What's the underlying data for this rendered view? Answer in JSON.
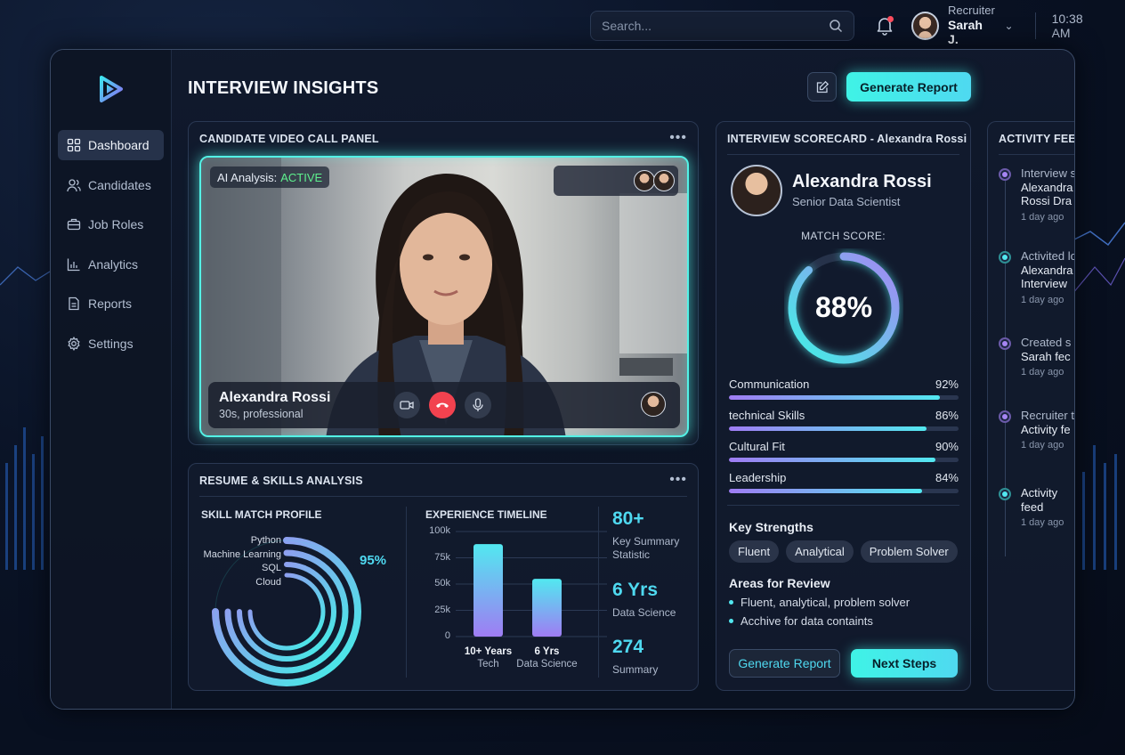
{
  "topbar": {
    "search_placeholder": "Search...",
    "user_role": "Recruiter",
    "user_name": "Sarah J.",
    "time": "10:38 AM"
  },
  "sidebar": {
    "items": [
      {
        "label": "Dashboard",
        "icon": "grid-icon",
        "active": true
      },
      {
        "label": "Candidates",
        "icon": "users-icon"
      },
      {
        "label": "Job Roles",
        "icon": "briefcase-icon"
      },
      {
        "label": "Analytics",
        "icon": "bar-chart-icon"
      },
      {
        "label": "Reports",
        "icon": "document-icon"
      },
      {
        "label": "Settings",
        "icon": "gear-icon"
      }
    ]
  },
  "header": {
    "title": "INTERVIEW INSIGHTS",
    "generate_label": "Generate Report"
  },
  "video_panel": {
    "title": "CANDIDATE VIDEO CALL PANEL",
    "ai_label": "AI Analysis:",
    "ai_status": "ACTIVE",
    "candidate_name": "Alexandra Rossi",
    "candidate_sub": "30s, professional"
  },
  "resume": {
    "title": "RESUME & SKILLS ANALYSIS",
    "skill_title": "SKILL MATCH PROFILE",
    "skills": [
      "Python",
      "Machine Learning",
      "SQL",
      "Cloud"
    ],
    "skill_percent": "95%",
    "timeline_title": "EXPERIENCE TIMELINE",
    "stats": [
      {
        "value": "80+",
        "label": "Key Summary Statistic"
      },
      {
        "value": "6 Yrs",
        "label": "Data Science"
      },
      {
        "value": "274",
        "label": "Summary"
      }
    ]
  },
  "chart_data": {
    "type": "bar",
    "title": "EXPERIENCE TIMELINE",
    "categories": [
      {
        "main": "10+ Years",
        "sub": "Tech"
      },
      {
        "main": "6 Yrs",
        "sub": "Data Science"
      }
    ],
    "values": [
      88000,
      55000
    ],
    "yticks": [
      "100k",
      "75k",
      "50k",
      "25k",
      "0"
    ],
    "ylim": [
      0,
      100000
    ],
    "grid": true
  },
  "scorecard": {
    "title": "INTERVIEW SCORECARD - Alexandra Rossi",
    "name": "Alexandra Rossi",
    "role": "Senior Data Scientist",
    "match_label": "MATCH SCORE:",
    "match_value": "88%",
    "match_fraction": 0.88,
    "metrics": [
      {
        "label": "Communication",
        "value": "92%",
        "fraction": 0.92
      },
      {
        "label": "technical Skills",
        "value": "86%",
        "fraction": 0.86
      },
      {
        "label": "Cultural Fit",
        "value": "90%",
        "fraction": 0.9
      },
      {
        "label": "Leadership",
        "value": "84%",
        "fraction": 0.84
      }
    ],
    "strengths_title": "Key Strengths",
    "strengths": [
      "Fluent",
      "Analytical",
      "Problem Solver"
    ],
    "review_title": "Areas for Review",
    "review_items": [
      "Fluent, analytical, problem solver",
      "Acchive for data containts"
    ],
    "generate_label": "Generate Report",
    "next_label": "Next Steps"
  },
  "feed": {
    "title": "ACTIVITY FEED",
    "items": [
      {
        "line1": "Interview s",
        "line2": "Alexandra",
        "line3": "Rossi Dra",
        "time": "1 day ago",
        "color": "purple"
      },
      {
        "line1": "Activited lo",
        "line2": "Alexandra",
        "line3": "Interview",
        "time": "1 day ago",
        "color": "cyan"
      },
      {
        "line1": "Created s",
        "line2": "Sarah fec",
        "line3": "",
        "time": "1 day ago",
        "color": "purple"
      },
      {
        "line1": "Recruiter t",
        "line2": "Activity fe",
        "line3": "",
        "time": "1 day ago",
        "color": "purple"
      },
      {
        "line1": "Activity",
        "line2": "feed",
        "line3": "",
        "time": "1 day ago",
        "color": "cyan"
      }
    ]
  },
  "colors": {
    "accent_cyan": "#4fd9f0",
    "accent_purple": "#9f7cf3",
    "active_green": "#5ef08e",
    "end_call_red": "#f2424f"
  }
}
